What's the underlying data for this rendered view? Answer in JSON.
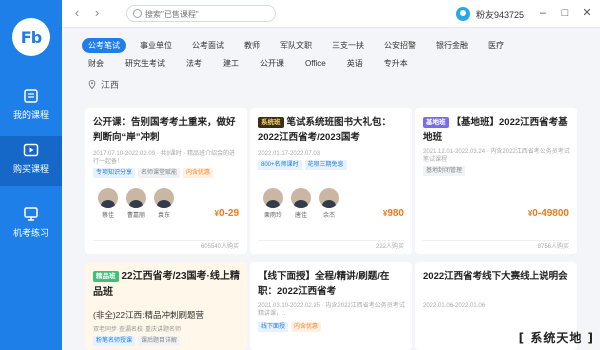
{
  "app": {
    "logo_text": "Fb"
  },
  "sidebar": {
    "items": [
      {
        "label": "我的课程",
        "icon": "book-icon"
      },
      {
        "label": "购买课程",
        "icon": "play-icon"
      },
      {
        "label": "机考练习",
        "icon": "exam-icon"
      }
    ]
  },
  "topbar": {
    "search_placeholder": "搜索\"已售课程\"",
    "username": "粉友943725"
  },
  "filters": {
    "row1": [
      "公考笔试",
      "事业单位",
      "公考面试",
      "教师",
      "军队文职",
      "三支一扶",
      "公安招警",
      "银行金融",
      "医疗"
    ],
    "row2": [
      "财会",
      "研究生考试",
      "法考",
      "建工",
      "公开课",
      "Office",
      "英语",
      "专升本"
    ],
    "active": "公考笔试",
    "location": "江西"
  },
  "cards": [
    {
      "title": "公开课：告别国考考土重来，做好判断向“岸”冲刺",
      "meta": "2017.07.10-2022.02.09 · 共9课时 · 精品班介绍会的进行一起备！",
      "labels": [
        "专项知识分享",
        "名师课堂赋能",
        "内含优惠"
      ],
      "teachers": [
        "蔡佳",
        "曹嘉丽",
        "袁东"
      ],
      "price": "0-29",
      "currency": "¥",
      "footer": "605540人购买"
    },
    {
      "tag": "系统班",
      "title": "笔试系统班图书大礼包：2022江西省考/2023国考",
      "meta": "2022.01.17-2022.07.03",
      "labels": [
        "800+名师课时",
        "花呗三期免息"
      ],
      "teachers": [
        "栗雨玲",
        "唐佳",
        "余杰"
      ],
      "price": "980",
      "currency": "¥",
      "footer": "222人购买"
    },
    {
      "tag": "基地班",
      "title": "【基地班】2022江西省考基地班",
      "meta": "2021.12.01-2022.03.24 · 内含2022江西省考公务员考试笔试课程",
      "labels": [
        "基地封闭管理"
      ],
      "teachers": [],
      "price": "0-49800",
      "currency": "¥",
      "footer": "8756人购买"
    },
    {
      "tag": "精品班",
      "title": "22江西省考/23国考·线上精品班",
      "sub": "(非全)22江西:精品冲刺刷题营",
      "meta": "双老同步·查漏名校·重庆讲题名师",
      "labels": [
        "粉笔名师授课",
        "课后题目详解"
      ]
    },
    {
      "title": "【线下面授】全程/精讲/刷题/在职：2022江西省考",
      "meta": "2021.03.10-2022.02.25 · 内含2022江西省考公务员考试精讲课，..",
      "labels": [
        "线下面授",
        "内含优惠"
      ]
    },
    {
      "title": "2022江西省考线下大赛线上说明会",
      "meta": "2022.01.06-2022.01.06",
      "labels": []
    }
  ],
  "watermark": "[ 系统天地 ]"
}
